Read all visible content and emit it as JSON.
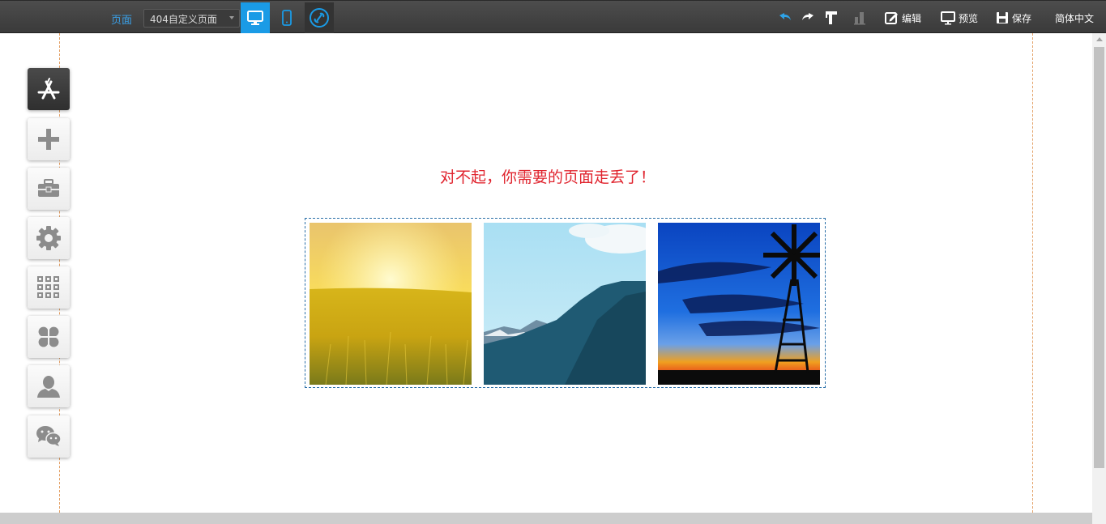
{
  "toolbar": {
    "page_label": "页面",
    "page_select_value": "404自定义页面",
    "edit_label": "编辑",
    "preview_label": "预览",
    "save_label": "保存",
    "language": "简体中文",
    "accent_color": "#1a9be6"
  },
  "sidebar": {
    "items": [
      {
        "icon": "app-store-icon",
        "active": true
      },
      {
        "icon": "plus-icon"
      },
      {
        "icon": "toolbox-icon"
      },
      {
        "icon": "gear-icon"
      },
      {
        "icon": "grid-icon"
      },
      {
        "icon": "clover-icon"
      },
      {
        "icon": "user-icon"
      },
      {
        "icon": "wechat-icon"
      }
    ]
  },
  "main": {
    "error_message": "对不起，你需要的页面走丢了！",
    "message_color": "#e0242e",
    "gallery": [
      {
        "scene": "wheat-field-sunrise"
      },
      {
        "scene": "mountain-sky"
      },
      {
        "scene": "windmill-sunset"
      }
    ]
  }
}
